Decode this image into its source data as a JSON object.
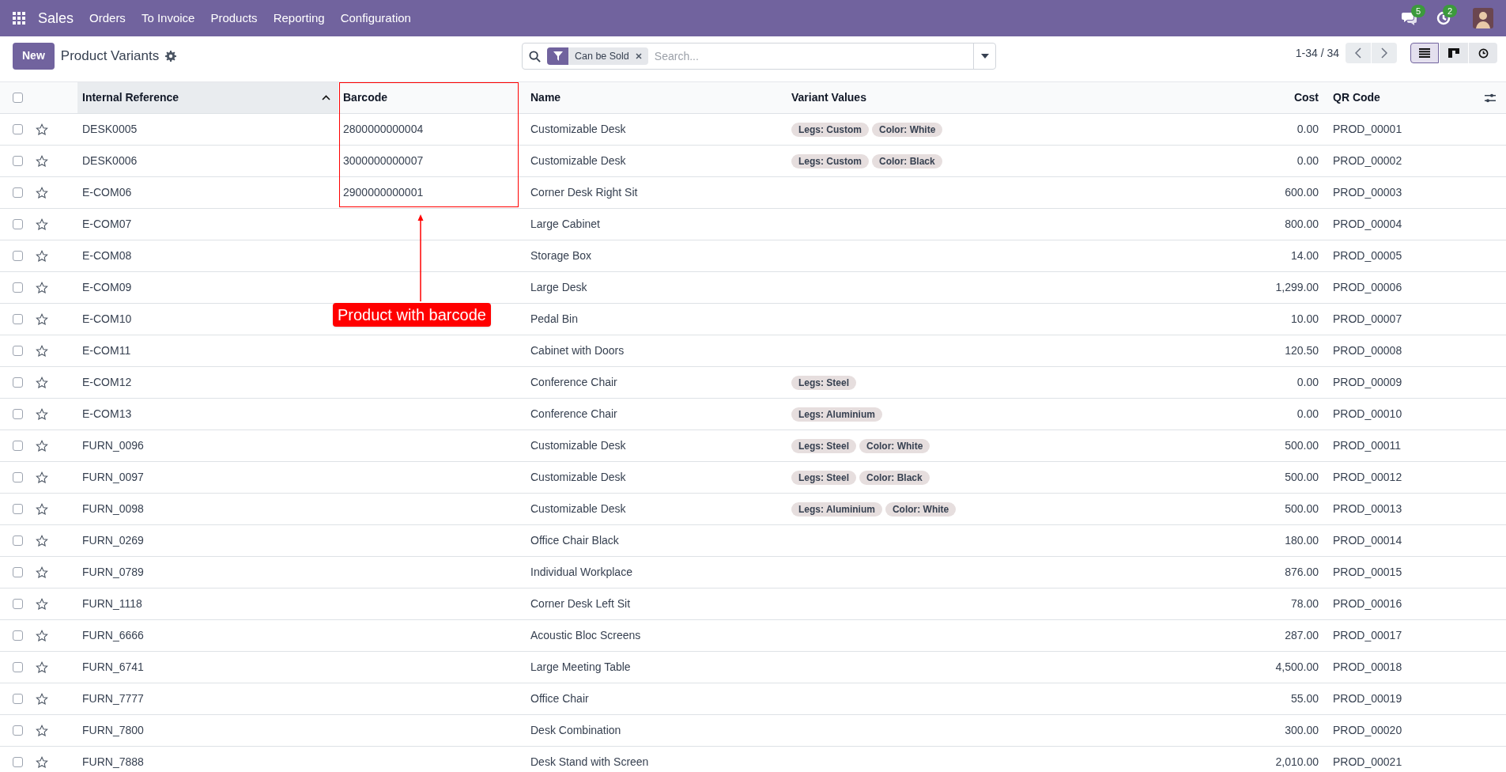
{
  "navbar": {
    "app": "Sales",
    "menu": [
      "Orders",
      "To Invoice",
      "Products",
      "Reporting",
      "Configuration"
    ],
    "messages_badge": "5",
    "activities_badge": "2"
  },
  "control_panel": {
    "new_button": "New",
    "title": "Product Variants",
    "search": {
      "facet": "Can be Sold",
      "placeholder": "Search..."
    },
    "pager": "1-34 / 34",
    "views": [
      {
        "kind": "list",
        "selected": true
      },
      {
        "kind": "kanban",
        "selected": false
      },
      {
        "kind": "activity",
        "selected": false
      }
    ]
  },
  "table": {
    "select_all": false,
    "columns": [
      {
        "label": "Internal Reference",
        "sorted": true
      },
      {
        "label": "Barcode",
        "sorted": false
      },
      {
        "label": "Name",
        "sorted": false
      },
      {
        "label": "Variant Values",
        "sorted": false
      },
      {
        "label": "Cost",
        "sorted": false
      },
      {
        "label": "QR Code",
        "sorted": false
      }
    ],
    "rows": [
      {
        "selected": false,
        "favorite": false,
        "ref": "DESK0005",
        "barcode": "2800000000004",
        "name": "Customizable Desk",
        "variants": [
          "Legs: Custom",
          "Color: White"
        ],
        "cost": "0.00",
        "qr": "PROD_00001"
      },
      {
        "selected": false,
        "favorite": false,
        "ref": "DESK0006",
        "barcode": "3000000000007",
        "name": "Customizable Desk",
        "variants": [
          "Legs: Custom",
          "Color: Black"
        ],
        "cost": "0.00",
        "qr": "PROD_00002"
      },
      {
        "selected": false,
        "favorite": false,
        "ref": "E-COM06",
        "barcode": "2900000000001",
        "name": "Corner Desk Right Sit",
        "variants": [],
        "cost": "600.00",
        "qr": "PROD_00003"
      },
      {
        "selected": false,
        "favorite": false,
        "ref": "E-COM07",
        "name": "Large Cabinet",
        "variants": [],
        "cost": "800.00",
        "qr": "PROD_00004"
      },
      {
        "selected": false,
        "favorite": false,
        "ref": "E-COM08",
        "name": "Storage Box",
        "variants": [],
        "cost": "14.00",
        "qr": "PROD_00005"
      },
      {
        "selected": false,
        "favorite": false,
        "ref": "E-COM09",
        "name": "Large Desk",
        "variants": [],
        "cost": "1,299.00",
        "qr": "PROD_00006"
      },
      {
        "selected": false,
        "favorite": false,
        "ref": "E-COM10",
        "name": "Pedal Bin",
        "variants": [],
        "cost": "10.00",
        "qr": "PROD_00007"
      },
      {
        "selected": false,
        "favorite": false,
        "ref": "E-COM11",
        "name": "Cabinet with Doors",
        "variants": [],
        "cost": "120.50",
        "qr": "PROD_00008"
      },
      {
        "selected": false,
        "favorite": false,
        "ref": "E-COM12",
        "name": "Conference Chair",
        "variants": [
          "Legs: Steel"
        ],
        "cost": "0.00",
        "qr": "PROD_00009"
      },
      {
        "selected": false,
        "favorite": false,
        "ref": "E-COM13",
        "name": "Conference Chair",
        "variants": [
          "Legs: Aluminium"
        ],
        "cost": "0.00",
        "qr": "PROD_00010"
      },
      {
        "selected": false,
        "favorite": false,
        "ref": "FURN_0096",
        "name": "Customizable Desk",
        "variants": [
          "Legs: Steel",
          "Color: White"
        ],
        "cost": "500.00",
        "qr": "PROD_00011"
      },
      {
        "selected": false,
        "favorite": false,
        "ref": "FURN_0097",
        "name": "Customizable Desk",
        "variants": [
          "Legs: Steel",
          "Color: Black"
        ],
        "cost": "500.00",
        "qr": "PROD_00012"
      },
      {
        "selected": false,
        "favorite": false,
        "ref": "FURN_0098",
        "name": "Customizable Desk",
        "variants": [
          "Legs: Aluminium",
          "Color: White"
        ],
        "cost": "500.00",
        "qr": "PROD_00013"
      },
      {
        "selected": false,
        "favorite": false,
        "ref": "FURN_0269",
        "name": "Office Chair Black",
        "variants": [],
        "cost": "180.00",
        "qr": "PROD_00014"
      },
      {
        "selected": false,
        "favorite": false,
        "ref": "FURN_0789",
        "name": "Individual Workplace",
        "variants": [],
        "cost": "876.00",
        "qr": "PROD_00015"
      },
      {
        "selected": false,
        "favorite": false,
        "ref": "FURN_1118",
        "name": "Corner Desk Left Sit",
        "variants": [],
        "cost": "78.00",
        "qr": "PROD_00016"
      },
      {
        "selected": false,
        "favorite": false,
        "ref": "FURN_6666",
        "name": "Acoustic Bloc Screens",
        "variants": [],
        "cost": "287.00",
        "qr": "PROD_00017"
      },
      {
        "selected": false,
        "favorite": false,
        "ref": "FURN_6741",
        "name": "Large Meeting Table",
        "variants": [],
        "cost": "4,500.00",
        "qr": "PROD_00018"
      },
      {
        "selected": false,
        "favorite": false,
        "ref": "FURN_7777",
        "name": "Office Chair",
        "variants": [],
        "cost": "55.00",
        "qr": "PROD_00019"
      },
      {
        "selected": false,
        "favorite": false,
        "ref": "FURN_7800",
        "name": "Desk Combination",
        "variants": [],
        "cost": "300.00",
        "qr": "PROD_00020"
      },
      {
        "selected": false,
        "favorite": false,
        "ref": "FURN_7888",
        "name": "Desk Stand with Screen",
        "variants": [],
        "cost": "2,010.00",
        "qr": "PROD_00021"
      }
    ]
  },
  "annotation": {
    "label": "Product with barcode"
  }
}
